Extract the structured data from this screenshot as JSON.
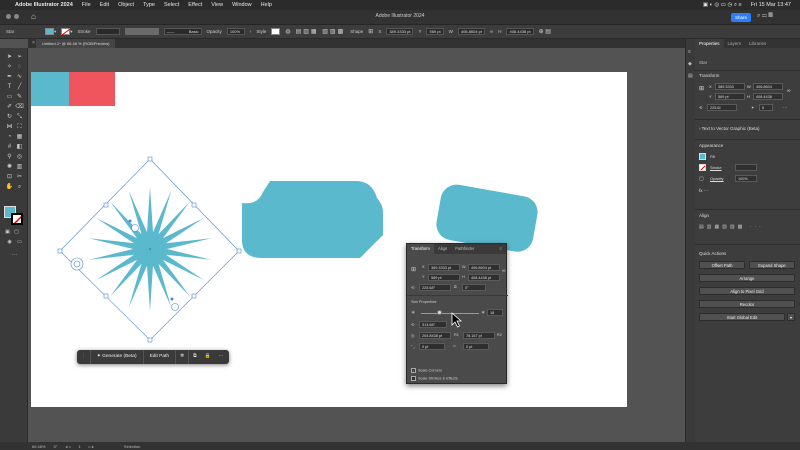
{
  "mac_menu": {
    "app": "Adobe Illustrator 2024",
    "items": [
      "File",
      "Edit",
      "Object",
      "Type",
      "Select",
      "Effect",
      "View",
      "Window",
      "Help"
    ],
    "clock": "Fri 15 Mar 13:47"
  },
  "window": {
    "title": "Adobe Illustrator 2024",
    "share": "Share"
  },
  "control_bar": {
    "selection": "Star",
    "stroke_label": "Stroke",
    "brush": "Basic",
    "opacity_label": "Opacity",
    "opacity": "100%",
    "style_label": "Style",
    "shape_label": "Shape",
    "x": "389.3333 pt",
    "y": "569 pt",
    "w": "406.8604 pt",
    "h": "408.4438 pt",
    "x_label": "X",
    "y_label": "Y",
    "w_label": "W",
    "h_label": "H",
    "fill_color": "#5BB9CE"
  },
  "document_tab": "Untitled-1* @ 66.46 % (RGB/Preview)",
  "status_bar": {
    "zoom": "66.46%",
    "rotation": "0°",
    "artboard": "1",
    "tool": "Selection"
  },
  "properties_panel": {
    "tabs": [
      "Properties",
      "Layers",
      "Libraries"
    ],
    "object": "Star",
    "transform_title": "Transform",
    "x_label": "X",
    "y_label": "Y",
    "w_label": "W",
    "h_label": "H",
    "x": "389.3333",
    "y": "569 pt",
    "w": "406.8604",
    "h": "408.4438",
    "angle": "225.6I",
    "points": "5",
    "text_vector": "Text to Vector Graphic (Beta)",
    "appearance_title": "Appearance",
    "fill_label": "Fill",
    "stroke_label": "Stroke",
    "opacity_label": "Opacity",
    "opacity": "100%",
    "align_title": "Align",
    "quick_actions_title": "Quick Actions",
    "buttons": {
      "offset_path": "Offset Path",
      "expand_shape": "Expand Shape",
      "arrange": "Arrange",
      "align_pixel": "Align to Pixel Grid",
      "recolor": "Recolor",
      "start_global_edit": "Start Global Edit"
    }
  },
  "transform_panel": {
    "tabs": [
      "Transform",
      "Align",
      "Pathfinder"
    ],
    "x_label": "X",
    "y_label": "Y",
    "w_label": "W",
    "h_label": "H",
    "x": "389.3333 pt",
    "y": "569 pt",
    "w": "406.8604 pt",
    "h": "408.4438 pt",
    "angle": "225.68°",
    "shear": "0°",
    "star_title": "Star Properties:",
    "points": "18",
    "star_angle": "313.68°",
    "r1_label": "R1",
    "r2_label": "R2",
    "radius1": "204.8438 pt",
    "radius2": "78.167 pt",
    "corner1": "0 pt",
    "corner2": "0 pt",
    "scale_corners": "Scale Corners",
    "scale_strokes": "Scale Strokes & Effects",
    "scale_corners_checked": true,
    "scale_strokes_checked": false
  },
  "context_bar": {
    "generate": "Generate (Beta)",
    "edit_path": "Edit Path"
  },
  "artwork_colors": {
    "teal": "#5BB9CE",
    "coral": "#F0555E"
  }
}
